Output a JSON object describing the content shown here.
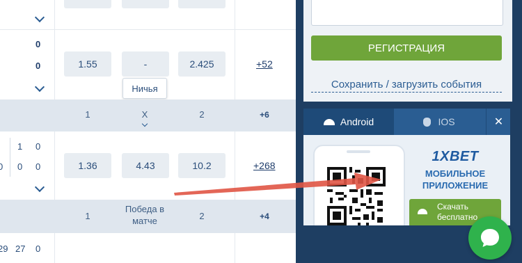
{
  "events": [
    {
      "scores": [
        "0",
        "0"
      ],
      "odds": [
        "1.55",
        "-",
        "2.425"
      ],
      "more": "+52",
      "tooltip": "Ничья"
    },
    {
      "scores_a": [
        "1",
        "0"
      ],
      "scores_b": [
        "0",
        "0",
        "0"
      ],
      "odds": [
        "1.36",
        "4.43",
        "10.2"
      ],
      "more": "+268"
    },
    {
      "scores": [
        "29",
        "27",
        "0"
      ]
    }
  ],
  "headers": [
    {
      "c1": "1",
      "cx": "X",
      "c2": "2",
      "more": "+6"
    },
    {
      "c1": "1",
      "cx_line1": "Победа в",
      "cx_line2": "матче",
      "c2": "2",
      "more": "+4"
    }
  ],
  "sidebar": {
    "register_label": "РЕГИСТРАЦИЯ",
    "save_load_label": "Сохранить / загрузить события",
    "tabs": [
      {
        "label": "Android"
      },
      {
        "label": "IOS"
      }
    ],
    "close": "✕",
    "app": {
      "brand": "1XBET",
      "line1": "МОБИЛЬНОЕ",
      "line2": "ПРИЛОЖЕНИЕ",
      "download_line1": "Скачать",
      "download_line2": "бесплатно"
    }
  },
  "colors": {
    "accent_green": "#6fa53a",
    "sidebar_dark": "#1e3e62",
    "chat_green": "#2fb24c",
    "arrow_red": "#e05545"
  }
}
